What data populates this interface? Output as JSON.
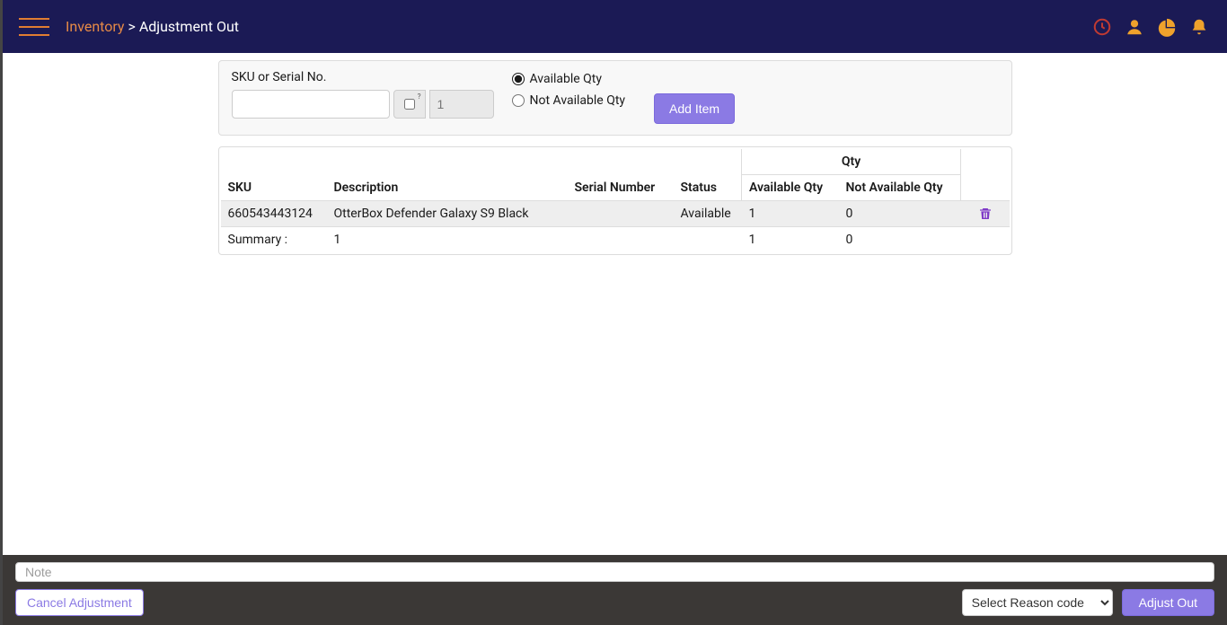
{
  "breadcrumb": {
    "root": "Inventory",
    "sep": ">",
    "page": "Adjustment Out"
  },
  "filter": {
    "label": "SKU or Serial No.",
    "qty_placeholder": "1",
    "radios": {
      "available": "Available Qty",
      "not_available": "Not Available Qty"
    },
    "add_button": "Add Item"
  },
  "table": {
    "group_header": "Qty",
    "columns": [
      "SKU",
      "Description",
      "Serial Number",
      "Status",
      "Available Qty",
      "Not Available Qty",
      ""
    ],
    "rows": [
      {
        "sku": "660543443124",
        "description": "OtterBox Defender Galaxy S9 Black",
        "serial": "",
        "status": "Available",
        "available_qty": "1",
        "not_available_qty": "0"
      }
    ],
    "summary": {
      "label": "Summary :",
      "count": "1",
      "available_qty": "1",
      "not_available_qty": "0"
    }
  },
  "footer": {
    "note_placeholder": "Note",
    "cancel": "Cancel Adjustment",
    "reason_placeholder": "Select Reason code",
    "adjust": "Adjust Out"
  }
}
